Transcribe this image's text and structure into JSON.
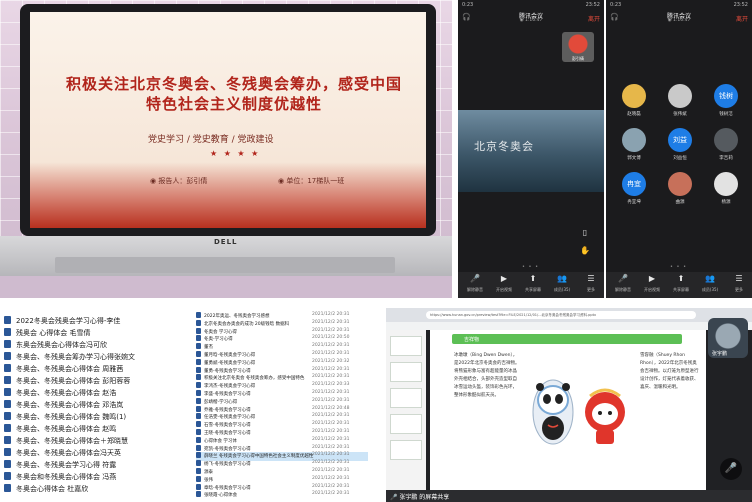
{
  "panel1": {
    "slide_title": "积极关注北京冬奥会、冬残奥会筹办，感受中国特色社会主义制度优越性",
    "slide_subtitle": "党史学习 / 党史教育 / 党政建设",
    "slide_dots": "★ ★ ★ ★",
    "reporter": "◉ 报告人：彭引倩",
    "unit": "◉ 单位：17梯队一班",
    "brand": "DELL"
  },
  "panel2": {
    "status_left": "0:23",
    "status_right": "23:52",
    "meeting_title": "腾讯会议",
    "meeting_sub": "◉ 1:16:47",
    "leave_label": "离开",
    "video_text": "北京冬奥会",
    "selfcam_name": "彭引倩",
    "pager": "• • •",
    "footer": [
      {
        "icon": "mic-icon",
        "glyph": "🎤",
        "label": "解除静音"
      },
      {
        "icon": "camera-icon",
        "glyph": "▶",
        "label": "开启视频"
      },
      {
        "icon": "share-icon",
        "glyph": "⬆",
        "label": "共享屏幕"
      },
      {
        "icon": "members-icon",
        "glyph": "👥",
        "label": "成员(35)"
      },
      {
        "icon": "more-icon",
        "glyph": "☰",
        "label": "更多"
      }
    ]
  },
  "panel3": {
    "status_left": "0:23",
    "status_right": "23:52",
    "meeting_title": "腾讯会议",
    "meeting_sub": "◉ 1:16:47",
    "leave_label": "离开",
    "pager": "• • •",
    "participants": [
      {
        "name": "赵晓磊",
        "initial": "",
        "color": "#e6b74a"
      },
      {
        "name": "张伟斌",
        "initial": "",
        "color": "#c9c9c9"
      },
      {
        "name": "钱树洁",
        "initial": "钱树",
        "color": "#1e7de6"
      },
      {
        "name": "郭文博",
        "initial": "",
        "color": "#8aa2b0"
      },
      {
        "name": "刘益恒",
        "initial": "刘益",
        "color": "#1e7de6"
      },
      {
        "name": "李吉莉",
        "initial": "",
        "color": "#555a5f"
      },
      {
        "name": "冉宜坤",
        "initial": "冉宜",
        "color": "#1e7de6"
      },
      {
        "name": "曲源",
        "initial": "",
        "color": "#c7705a"
      },
      {
        "name": "杨源",
        "initial": "",
        "color": "#e2e2e2"
      }
    ],
    "footer": [
      {
        "icon": "mic-icon",
        "glyph": "🎤",
        "label": "解除静音"
      },
      {
        "icon": "camera-icon",
        "glyph": "▶",
        "label": "开启视频"
      },
      {
        "icon": "share-icon",
        "glyph": "⬆",
        "label": "共享屏幕"
      },
      {
        "icon": "members-icon",
        "glyph": "👥",
        "label": "成员(35)"
      },
      {
        "icon": "more-icon",
        "glyph": "☰",
        "label": "更多"
      }
    ]
  },
  "panel4": {
    "big_files": [
      "2022冬奥会残奥会学习心得-李佳",
      "残奥会  心得体会 毛雪倩",
      "东奥会残奥会心得体会冯可欣",
      "冬奥会、冬残奥会筹办学习心得张婉文",
      "冬奥会、冬残奥会心得体会 周雅茜",
      "冬奥会、冬残奥会心得体会 彭阳蓉蓉",
      "冬奥会、冬残奥会心得体会  赵浩",
      "冬奥会、冬残奥会心得体会 邓浩岚",
      "冬奥会、冬残奥会心得体会 魏鸣(1)",
      "冬奥会、冬残奥会心得体会 赵鸣",
      "冬奥会、冬残奥会心得体会＋郑晓慧",
      "冬奥会、冬残奥会心得体会冯天英",
      "冬奥会、冬残奥会学习心得  符露",
      "冬奥会和冬残奥会心得体会  冯燕",
      "冬奥会心得体会 杜嘉欣"
    ],
    "small_files": [
      {
        "name": "2022年奥运、冬残奥会学习感想",
        "date": "2021/12/2 20:31"
      },
      {
        "name": "北京冬奥会办奥会的成功  20级钱晗 数据科",
        "date": "2021/12/2 20:31"
      },
      {
        "name": "冬奥会 学习心得",
        "date": "2021/12/2 20:31"
      },
      {
        "name": "冬奥-学习心得",
        "date": "2021/12/2 20:50"
      },
      {
        "name": "董杰",
        "date": "2021/12/2 20:31"
      },
      {
        "name": "董月晗-冬残奥会学习心得",
        "date": "2021/12/2 20:31"
      },
      {
        "name": "董勇斌-冬残奥会学习心得",
        "date": "2021/12/2 20:32"
      },
      {
        "name": "董勇-冬残奥会学习心得",
        "date": "2021/12/2 20:31"
      },
      {
        "name": "积极关注北京冬奥会  冬残奥会筹办，感受中国特色",
        "date": "2021/12/2 20:31"
      },
      {
        "name": "李鸿杰-冬残奥会学习心得",
        "date": "2021/12/2 20:33"
      },
      {
        "name": "李盛-冬残奥会学习心得",
        "date": "2021/12/2 20:31"
      },
      {
        "name": "彭靖楷-学习心得",
        "date": "2021/12/2 20:31"
      },
      {
        "name": "乔雅-冬残奥会学习心得",
        "date": "2021/12/2 20:48"
      },
      {
        "name": "任浩雯-冬残奥会学习心得",
        "date": "2021/12/2 20:31"
      },
      {
        "name": "石雪-冬残奥会学习心得",
        "date": "2021/12/2 20:31"
      },
      {
        "name": "王晓-冬残奥会学习心得",
        "date": "2021/12/2 20:31"
      },
      {
        "name": "心得体会 学习体",
        "date": "2021/12/2 20:31"
      },
      {
        "name": "宛凯-冬残奥会学习心得",
        "date": "2021/12/2 20:31"
      },
      {
        "name": "薛晓兰  冬残奥会学习心得中国特色社会主义制度优越性",
        "date": "2021/12/2 20:31"
      },
      {
        "name": "杨飞-冬残奥会学习心得",
        "date": "2021/12/2 20:31"
      },
      {
        "name": "源泰",
        "date": "2021/12/2 20:31"
      },
      {
        "name": "张伟",
        "date": "2021/12/2 20:31"
      },
      {
        "name": "章晗-冬残奥会学习心得",
        "date": "2021/12/2 20:31"
      },
      {
        "name": "张晓霞-心得体会",
        "date": "2021/12/2 20:31"
      }
    ],
    "selected_index": 18
  },
  "panel5": {
    "url": "https://www.hunan.gov.cn/preview/test?file=FILE/2021/12/01/...北京冬奥会冬残奥会学习资料.pptx",
    "section_label": "吉祥物",
    "left_text": "冰墩墩（Bing Dwen Dwen），是2022年北京冬奥会的吉祥物。将熊猫形象与富有超能量的冰晶外壳相结合，头部外壳造型取自冰雪运动头盔，装饰彩色光环，整体形象酷似航天员。",
    "right_text": "雪容融（Shuey Rhon Rhon），2022年北京冬残奥会吉祥物。以灯笼为原型进行设计创作，灯笼代表着收获、喜庆、温暖和光明。",
    "camera_name": "张宇鹏",
    "share_label": "🎤 张宇鹏 的屏幕共享"
  }
}
